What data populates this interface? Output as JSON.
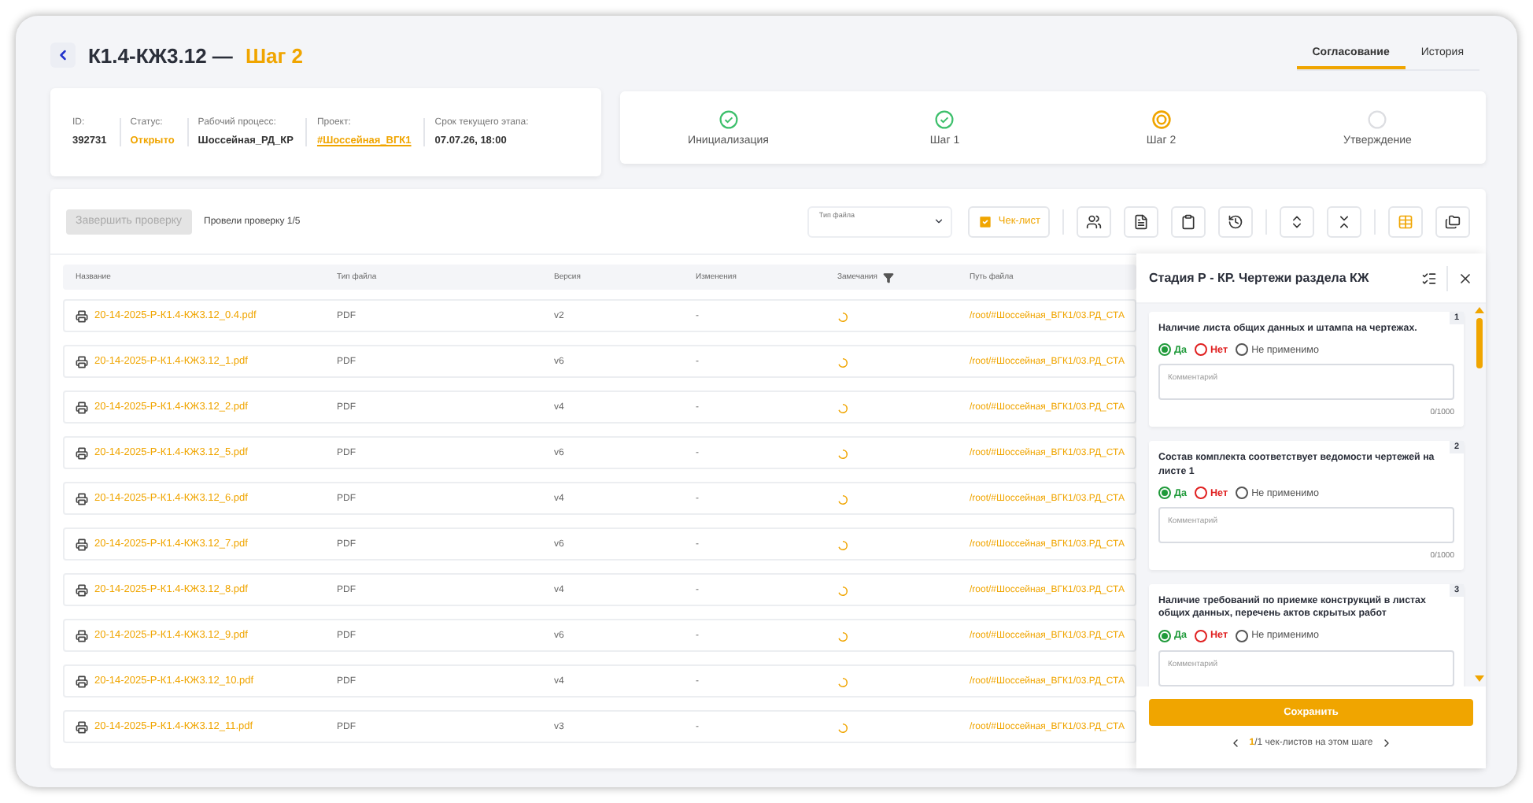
{
  "header": {
    "title": "К1.4-КЖ3.12 —",
    "step": "Шаг 2"
  },
  "tabs": [
    {
      "label": "Согласование",
      "selected": true
    },
    {
      "label": "История",
      "selected": false
    }
  ],
  "info": [
    {
      "label": "ID:",
      "value": "392731",
      "kind": "plain"
    },
    {
      "label": "Статус:",
      "value": "Открыто",
      "kind": "status"
    },
    {
      "label": "Рабочий процесс:",
      "value": "Шоссейная_РД_КР",
      "kind": "plain"
    },
    {
      "label": "Проект:",
      "value": "#Шоссейная_ВГК1",
      "kind": "link"
    },
    {
      "label": "Срок текущего этапа:",
      "value": "07.07.26, 18:00",
      "kind": "plain"
    }
  ],
  "steps": [
    {
      "label": "Инициализация",
      "completed": true,
      "current": false
    },
    {
      "label": "Шаг 1",
      "completed": true,
      "current": false
    },
    {
      "label": "Шаг 2",
      "completed": false,
      "current": true
    },
    {
      "label": "Утверждение",
      "completed": false,
      "current": false
    }
  ],
  "toolbar": {
    "finish_button": {
      "label": "Завершить проверку",
      "disabled": true
    },
    "progress": "Провели проверку 1/5",
    "file_type_label": "Тип файла",
    "checklist_button": {
      "label": "Чек-лист",
      "active": true
    },
    "tools": [
      {
        "kind": "users"
      },
      {
        "kind": "file"
      },
      {
        "kind": "clipboard"
      },
      {
        "kind": "history"
      }
    ],
    "tree": [
      {
        "kind": "expand"
      },
      {
        "kind": "collapse"
      }
    ],
    "views": [
      {
        "kind": "table",
        "selected": true
      },
      {
        "kind": "folders",
        "selected": false
      }
    ]
  },
  "table": {
    "columns": [
      "Название",
      "Тип файла",
      "Версия",
      "Изменения",
      "Замечания",
      "Путь файла"
    ],
    "rows": [
      {
        "name": "20-14-2025-Р-К1.4-КЖ3.12_0.4.pdf",
        "type": "PDF",
        "version": "v2",
        "changes": "-",
        "path": "/root/#Шоссейная_ВГК1/03.РД_СТА"
      },
      {
        "name": "20-14-2025-Р-К1.4-КЖ3.12_1.pdf",
        "type": "PDF",
        "version": "v6",
        "changes": "-",
        "path": "/root/#Шоссейная_ВГК1/03.РД_СТА"
      },
      {
        "name": "20-14-2025-Р-К1.4-КЖ3.12_2.pdf",
        "type": "PDF",
        "version": "v4",
        "changes": "-",
        "path": "/root/#Шоссейная_ВГК1/03.РД_СТА"
      },
      {
        "name": "20-14-2025-Р-К1.4-КЖ3.12_5.pdf",
        "type": "PDF",
        "version": "v6",
        "changes": "-",
        "path": "/root/#Шоссейная_ВГК1/03.РД_СТА"
      },
      {
        "name": "20-14-2025-Р-К1.4-КЖ3.12_6.pdf",
        "type": "PDF",
        "version": "v4",
        "changes": "-",
        "path": "/root/#Шоссейная_ВГК1/03.РД_СТА"
      },
      {
        "name": "20-14-2025-Р-К1.4-КЖ3.12_7.pdf",
        "type": "PDF",
        "version": "v6",
        "changes": "-",
        "path": "/root/#Шоссейная_ВГК1/03.РД_СТА"
      },
      {
        "name": "20-14-2025-Р-К1.4-КЖ3.12_8.pdf",
        "type": "PDF",
        "version": "v4",
        "changes": "-",
        "path": "/root/#Шоссейная_ВГК1/03.РД_СТА"
      },
      {
        "name": "20-14-2025-Р-К1.4-КЖ3.12_9.pdf",
        "type": "PDF",
        "version": "v6",
        "changes": "-",
        "path": "/root/#Шоссейная_ВГК1/03.РД_СТА"
      },
      {
        "name": "20-14-2025-Р-К1.4-КЖ3.12_10.pdf",
        "type": "PDF",
        "version": "v4",
        "changes": "-",
        "path": "/root/#Шоссейная_ВГК1/03.РД_СТА"
      },
      {
        "name": "20-14-2025-Р-К1.4-КЖ3.12_11.pdf",
        "type": "PDF",
        "version": "v3",
        "changes": "-",
        "path": "/root/#Шоссейная_ВГК1/03.РД_СТА"
      }
    ]
  },
  "checklist": {
    "title": "Стадия Р - КР. Чертежи раздела КЖ",
    "items": [
      {
        "number": "1",
        "question": "Наличие листа общих данных и штампа на чертежах.",
        "options": [
          {
            "label": "Да",
            "kind": "yes",
            "selected": true
          },
          {
            "label": "Нет",
            "kind": "no",
            "selected": false
          },
          {
            "label": "Не применимо",
            "kind": "na",
            "selected": false
          }
        ],
        "placeholder": "Комментарий",
        "counter": "0/1000"
      },
      {
        "number": "2",
        "question": "Состав комплекта соответствует ведомости чертежей на листе 1",
        "options": [
          {
            "label": "Да",
            "kind": "yes",
            "selected": true
          },
          {
            "label": "Нет",
            "kind": "no",
            "selected": false
          },
          {
            "label": "Не применимо",
            "kind": "na",
            "selected": false
          }
        ],
        "placeholder": "Комментарий",
        "counter": "0/1000"
      },
      {
        "number": "3",
        "question": "Наличие требований по приемке конструкций в листах общих данных, перечень актов скрытых работ",
        "options": [
          {
            "label": "Да",
            "kind": "yes",
            "selected": true
          },
          {
            "label": "Нет",
            "kind": "no",
            "selected": false
          },
          {
            "label": "Не применимо",
            "kind": "na",
            "selected": false
          }
        ],
        "placeholder": "Комментарий"
      }
    ],
    "save_button": "Сохранить",
    "pager_current": "1",
    "pager_rest": "/1 чек-листов на этом шаге"
  }
}
